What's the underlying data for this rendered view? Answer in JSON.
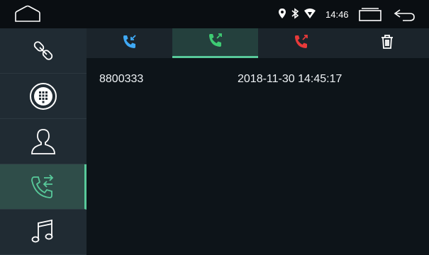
{
  "status_bar": {
    "time": "14:46",
    "icons": [
      "location-icon",
      "bluetooth-icon",
      "wifi-icon"
    ]
  },
  "sidebar": {
    "items": [
      {
        "name": "bluetooth-link-icon",
        "active": false
      },
      {
        "name": "dialpad-icon",
        "active": false
      },
      {
        "name": "contacts-icon",
        "active": false
      },
      {
        "name": "call-log-icon",
        "active": true
      },
      {
        "name": "music-icon",
        "active": false
      }
    ]
  },
  "tabs": [
    {
      "name": "incoming-calls-icon",
      "color": "#3fa9f5",
      "active": false
    },
    {
      "name": "outgoing-calls-icon",
      "color": "#3ecb73",
      "active": true
    },
    {
      "name": "missed-calls-icon",
      "color": "#e83a3a",
      "active": false
    },
    {
      "name": "trash-icon",
      "color": "#ffffff",
      "active": false
    }
  ],
  "call_log": [
    {
      "number": "8800333",
      "datetime": "2018-11-30 14:45:17"
    }
  ],
  "colors": {
    "accent": "#58c99a",
    "sidebar_bg": "#202b33",
    "content_bg": "#0d1419"
  }
}
